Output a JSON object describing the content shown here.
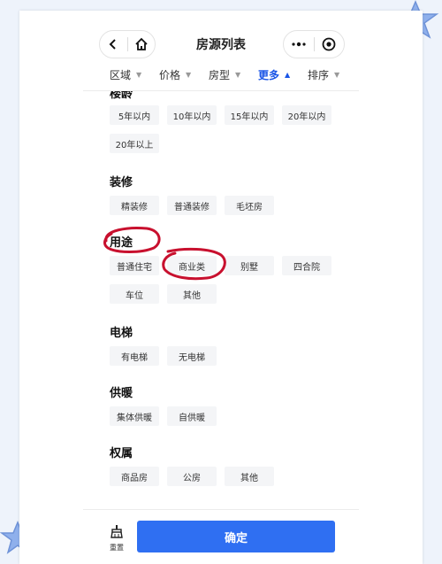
{
  "nav": {
    "title": "房源列表",
    "back_icon": "chevron-left-icon",
    "home_icon": "home-icon",
    "more_icon": "more-dots-icon",
    "target_icon": "target-icon"
  },
  "tabs": [
    {
      "label": "区域",
      "active": false
    },
    {
      "label": "价格",
      "active": false
    },
    {
      "label": "房型",
      "active": false
    },
    {
      "label": "更多",
      "active": true
    },
    {
      "label": "排序",
      "active": false
    }
  ],
  "caret_down": "▼",
  "caret_up": "▲",
  "sections": {
    "age": {
      "title": "楼龄",
      "options": [
        "5年以内",
        "10年以内",
        "15年以内",
        "20年以内",
        "20年以上"
      ]
    },
    "decor": {
      "title": "装修",
      "options": [
        "精装修",
        "普通装修",
        "毛坯房"
      ]
    },
    "usage": {
      "title": "用途",
      "options": [
        "普通住宅",
        "商业类",
        "别墅",
        "四合院",
        "车位",
        "其他"
      ]
    },
    "elevator": {
      "title": "电梯",
      "options": [
        "有电梯",
        "无电梯"
      ]
    },
    "heating": {
      "title": "供暖",
      "options": [
        "集体供暖",
        "自供暖"
      ]
    },
    "ownership": {
      "title": "权属",
      "options": [
        "商品房",
        "公房",
        "其他"
      ]
    }
  },
  "bottom": {
    "reset_label": "重置",
    "reset_icon": "broom-icon",
    "confirm_label": "确定"
  },
  "colors": {
    "accent": "#2f6ff2",
    "active_tab": "#1a55e6",
    "annotation": "#c8102e",
    "star": "#7ea4e8"
  }
}
